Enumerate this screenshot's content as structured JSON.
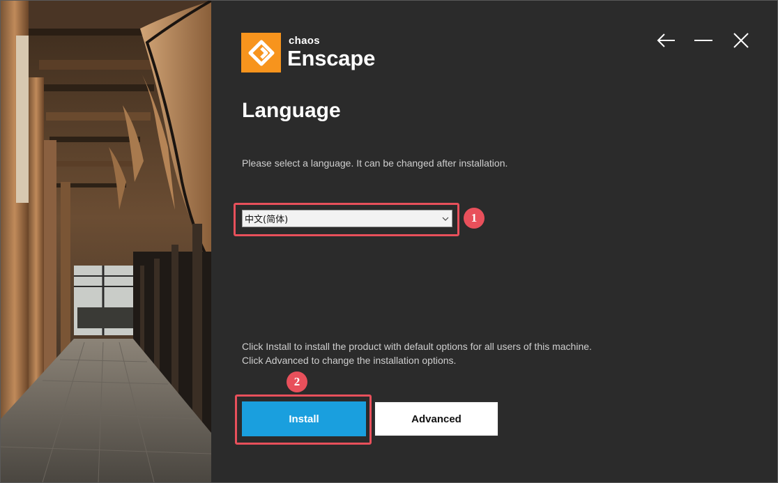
{
  "window": {
    "controls": [
      {
        "name": "back-arrow-icon"
      },
      {
        "name": "minimize-icon"
      },
      {
        "name": "close-icon"
      }
    ]
  },
  "logo": {
    "company": "chaos",
    "product": "Enscape",
    "brand_color": "#f7941d"
  },
  "page": {
    "title": "Language",
    "prompt": "Please select a language. It can be changed after installation."
  },
  "language_select": {
    "selected": "中文(简体)"
  },
  "annotations": {
    "step1": "1",
    "step2": "2",
    "highlight_color": "#e8505b"
  },
  "info": {
    "line1": "Click Install to install the product with default options for all users of this machine.",
    "line2": "Click Advanced to change the installation options."
  },
  "buttons": {
    "install": "Install",
    "advanced": "Advanced",
    "install_color": "#1a9fde"
  }
}
